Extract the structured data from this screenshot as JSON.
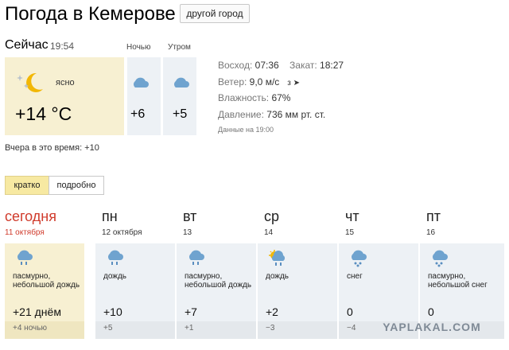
{
  "header": {
    "title": "Погода в Кемерове",
    "city_button": "другой город"
  },
  "now": {
    "label": "Сейчас",
    "time": "19:54",
    "condition": "ясно",
    "temp": "+14 °C",
    "icon": "moon-icon",
    "parts": [
      {
        "label": "Ночью",
        "temp": "+6",
        "icon": "cloud-icon"
      },
      {
        "label": "Утром",
        "temp": "+5",
        "icon": "cloud-icon"
      }
    ],
    "yesterday": "Вчера в это время: +10"
  },
  "info": {
    "sunrise_label": "Восход:",
    "sunrise": "07:36",
    "sunset_label": "Закат:",
    "sunset": "18:27",
    "wind_label": "Ветер:",
    "wind": "9,0 м/с",
    "wind_dir": "з ➤",
    "humidity_label": "Влажность:",
    "humidity": "67%",
    "pressure_label": "Давление:",
    "pressure": "736 мм рт. ст.",
    "data_time": "Данные на 19:00"
  },
  "tabs": {
    "short": "кратко",
    "long": "подробно"
  },
  "forecast": [
    {
      "name": "сегодня",
      "date": "11 октября",
      "condition": "пасмурно, небольшой дождь",
      "day": "+21 днём",
      "night": "+4 ночью",
      "icon": "cloud-rain-icon"
    },
    {
      "name": "пн",
      "date": "12 октября",
      "condition": "дождь",
      "day": "+10",
      "night": "+5",
      "icon": "cloud-rain-icon"
    },
    {
      "name": "вт",
      "date": "13",
      "condition": "пасмурно, небольшой дождь",
      "day": "+7",
      "night": "+1",
      "icon": "cloud-rain-icon"
    },
    {
      "name": "ср",
      "date": "14",
      "condition": "дождь",
      "day": "+2",
      "night": "−3",
      "icon": "sun-cloud-rain-icon"
    },
    {
      "name": "чт",
      "date": "15",
      "condition": "снег",
      "day": "0",
      "night": "−4",
      "icon": "cloud-snow-icon"
    },
    {
      "name": "пт",
      "date": "16",
      "condition": "пасмурно, небольшой снег",
      "day": "0",
      "night": "",
      "icon": "cloud-snow-icon"
    }
  ],
  "watermark": "YAPLAKAL.COM",
  "colors": {
    "today": "#d03b2c",
    "today_bg": "#f7f0d2",
    "card_bg": "#edf1f5",
    "tab_active": "#f7e9a2"
  }
}
